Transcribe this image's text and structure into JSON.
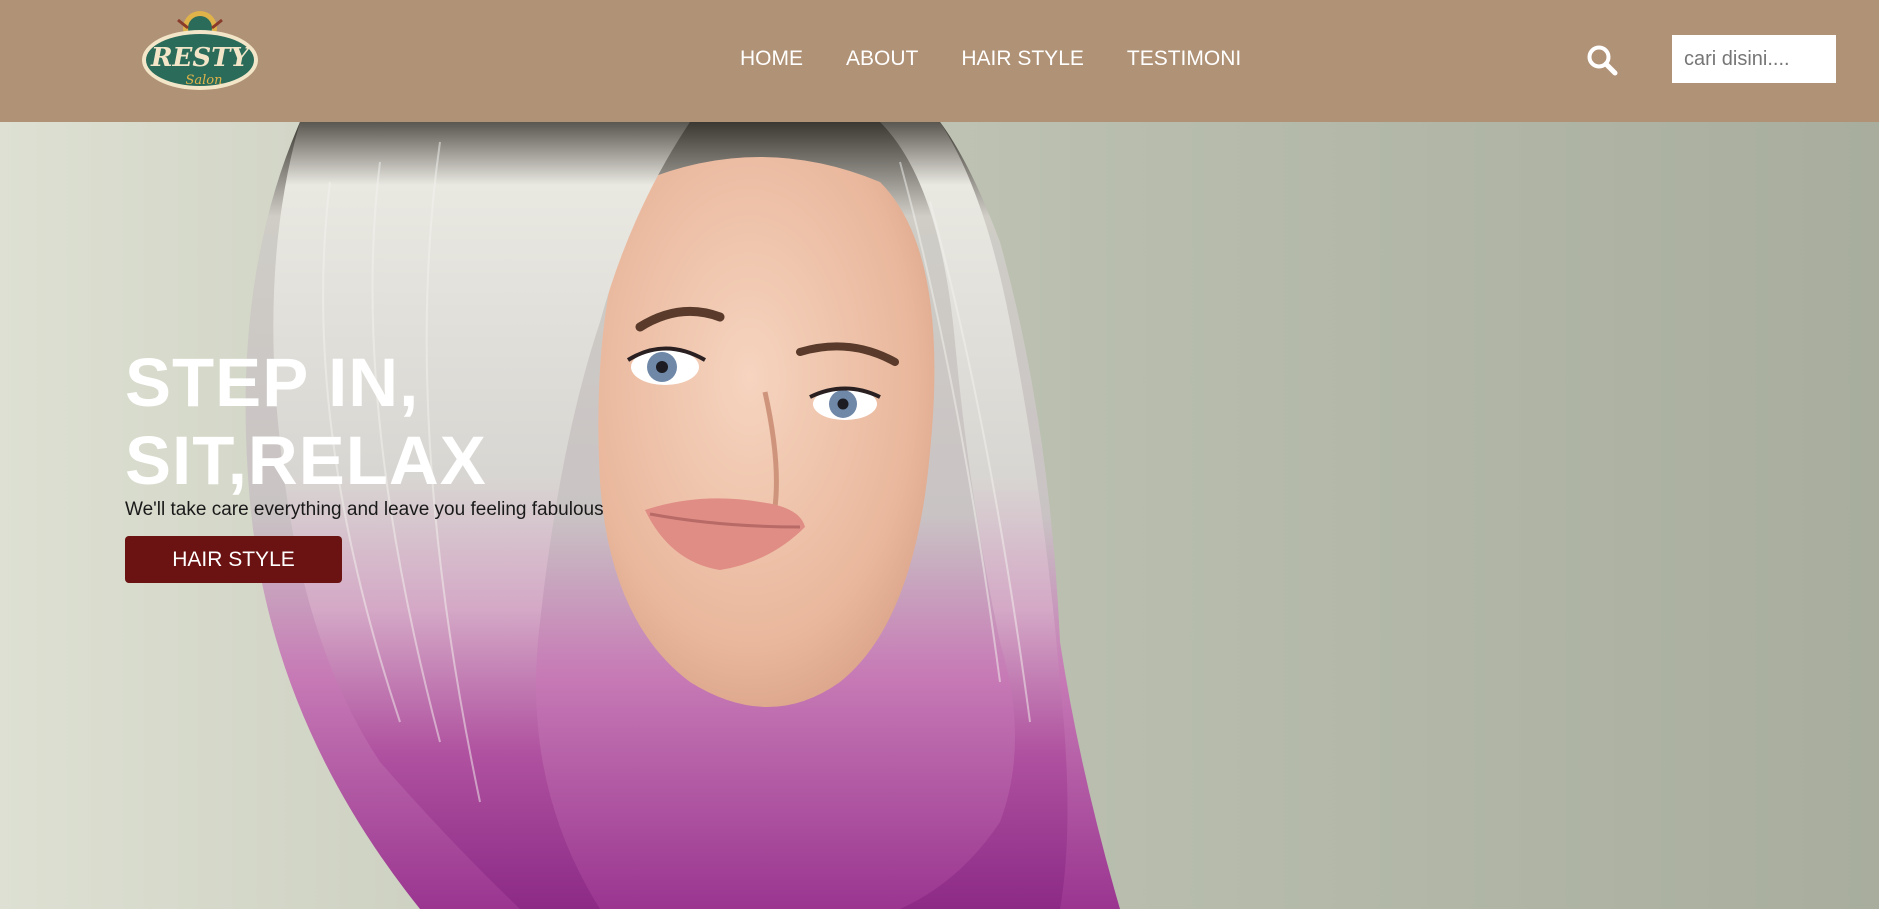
{
  "brand": {
    "logo_text_main": "RESTY",
    "logo_text_sub": "Salon",
    "logo_icon": "salon-logo-icon"
  },
  "nav": {
    "items": [
      {
        "label": "HOME"
      },
      {
        "label": "ABOUT"
      },
      {
        "label": "HAIR STYLE"
      },
      {
        "label": "TESTIMONI"
      }
    ]
  },
  "search": {
    "icon": "search-icon",
    "placeholder": "cari disini...."
  },
  "hero": {
    "title_line1": "STEP IN,",
    "title_line2": "SIT,RELAX",
    "subtitle": "We'll take care everything and leave you feeling fabulous",
    "button_label": "HAIR STYLE",
    "image": "woman-with-pink-ombre-bob-hair"
  },
  "colors": {
    "navbar": "#b09276",
    "button": "#6b1212",
    "logo_green": "#2a6b5a",
    "logo_gold": "#e0b24a"
  }
}
